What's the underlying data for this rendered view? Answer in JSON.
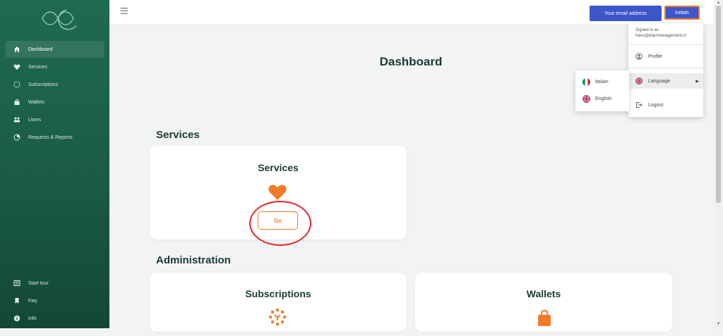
{
  "sidebar": {
    "items": [
      {
        "label": "Dashboard",
        "icon": "home-icon"
      },
      {
        "label": "Services",
        "icon": "heart-icon"
      },
      {
        "label": "Subscriptions",
        "icon": "subscriptions-icon"
      },
      {
        "label": "Wallets",
        "icon": "wallet-icon"
      },
      {
        "label": "Users",
        "icon": "users-icon"
      },
      {
        "label": "Requests & Reports",
        "icon": "reports-icon"
      }
    ],
    "bottom_items": [
      {
        "label": "Start tour",
        "icon": "tour-icon"
      },
      {
        "label": "Faq",
        "icon": "bookmark-icon"
      },
      {
        "label": "Info",
        "icon": "info-icon"
      }
    ]
  },
  "topbar": {
    "email_button": "Your email address",
    "user_button": "Initials"
  },
  "main": {
    "page_title": "Dashboard",
    "services_section": "Services",
    "services_card": {
      "title": "Services",
      "button": "Go"
    },
    "administration_section": "Administration",
    "subscriptions_card": {
      "title": "Subscriptions"
    },
    "wallets_card": {
      "title": "Wallets"
    }
  },
  "user_menu": {
    "signed_in_as": "Signed in as",
    "email": "hans@planmanagement.nl",
    "profile": "Profile",
    "language": "Language",
    "logout": "Logout"
  },
  "language_menu": {
    "options": [
      "Italian",
      "English"
    ]
  },
  "colors": {
    "sidebar": "#1f6a52",
    "accent": "#f27b2a",
    "primary_button": "#3d56c9",
    "highlight": "#e0262a"
  }
}
